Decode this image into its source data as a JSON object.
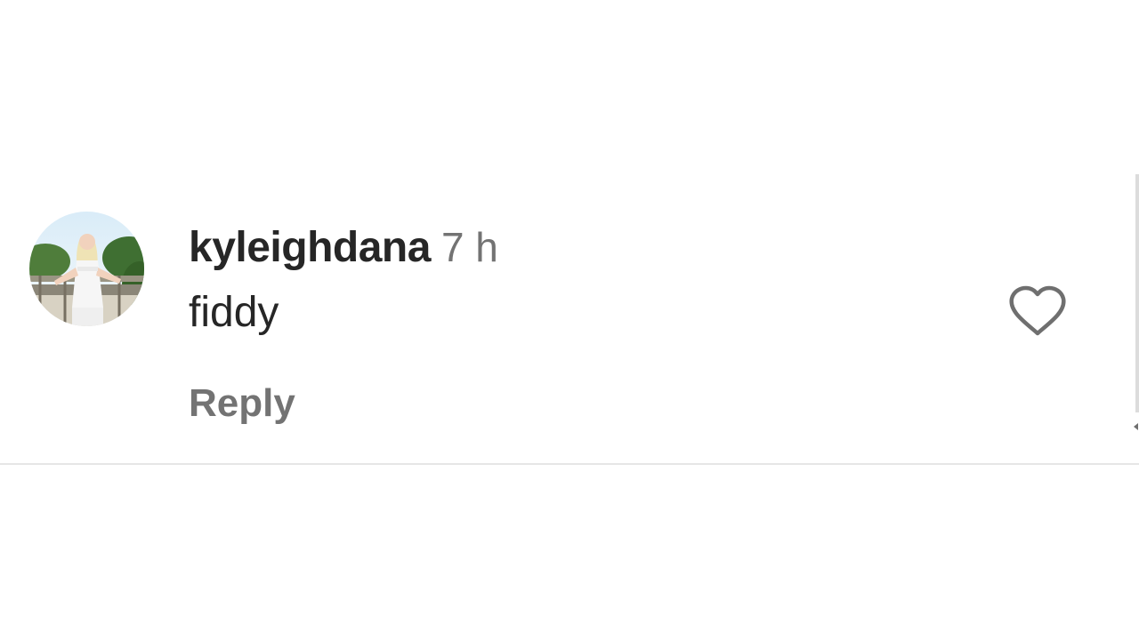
{
  "comment": {
    "username": "kyleighdana",
    "timestamp": "7 h",
    "text": "fiddy",
    "reply_label": "Reply",
    "avatar_icon": "profile-photo-avatar",
    "like_icon": "heart-outline-icon"
  },
  "colors": {
    "primary_text": "#262626",
    "secondary_text": "#737373",
    "divider": "#e6e6e6"
  }
}
